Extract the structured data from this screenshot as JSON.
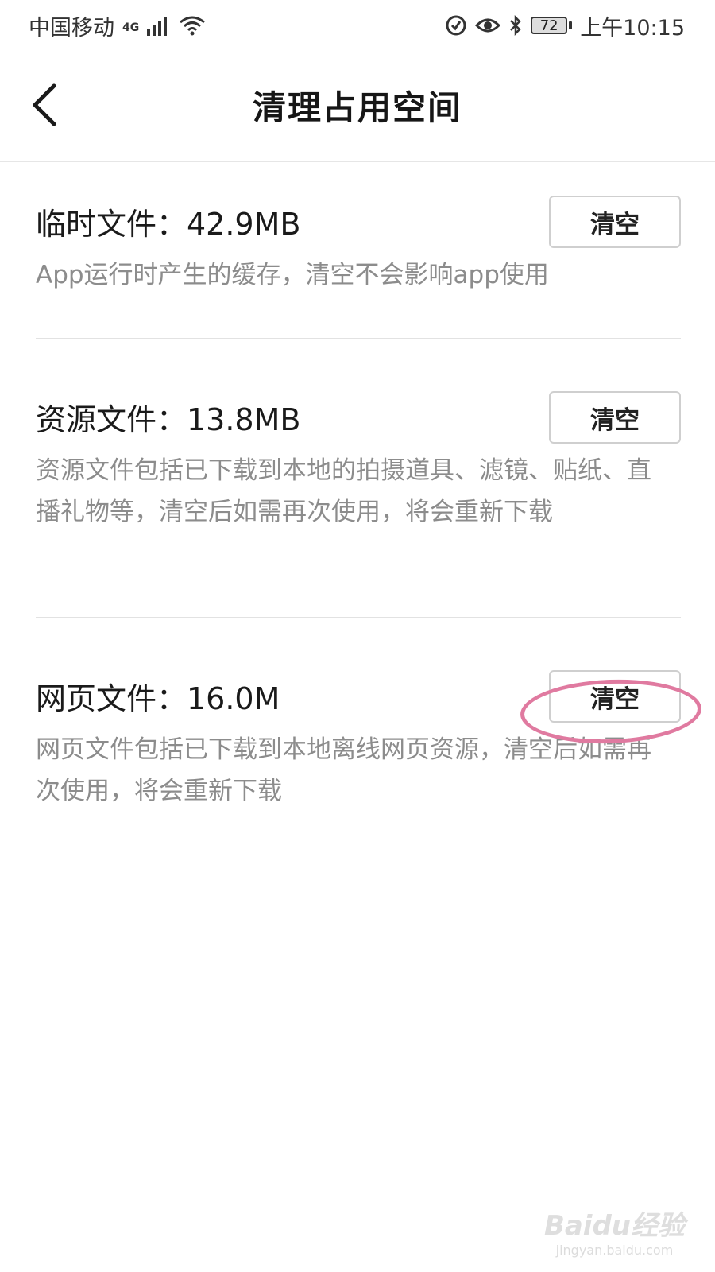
{
  "status_bar": {
    "carrier": "中国移动",
    "network": "4G",
    "battery": "72",
    "time": "上午10:15"
  },
  "header": {
    "title": "清理占用空间"
  },
  "sections": [
    {
      "title": "临时文件：42.9MB",
      "description": "App运行时产生的缓存，清空不会影响app使用",
      "button_label": "清空"
    },
    {
      "title": "资源文件：13.8MB",
      "description": "资源文件包括已下载到本地的拍摄道具、滤镜、贴纸、直播礼物等，清空后如需再次使用，将会重新下载",
      "button_label": "清空"
    },
    {
      "title": "网页文件：16.0M",
      "description": "网页文件包括已下载到本地离线网页资源，清空后如需再次使用，将会重新下载",
      "button_label": "清空"
    }
  ],
  "watermark": {
    "logo": "Baidu经验",
    "url": "jingyan.baidu.com"
  },
  "colors": {
    "highlight": "#e07aa0",
    "desc_text": "#8c8c8c"
  }
}
